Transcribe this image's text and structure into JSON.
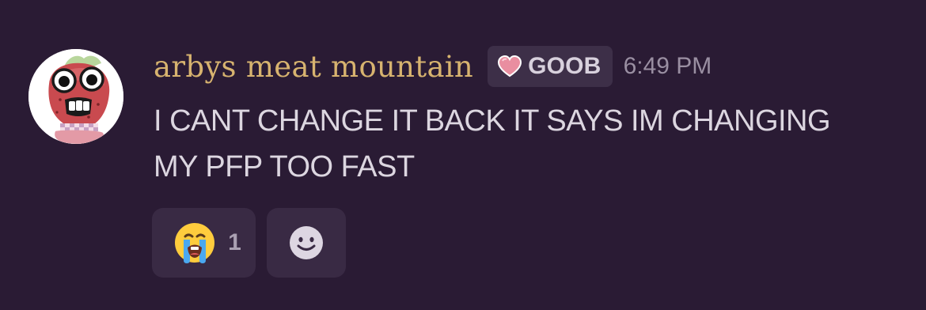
{
  "message": {
    "username": "arbys meat mountain",
    "tag": {
      "icon": "pink-heart-icon",
      "label": "GOOB"
    },
    "timestamp": "6:49 PM",
    "content": "I CANT CHANGE IT BACK IT SAYS IM CHANGING MY PFP TOO FAST",
    "avatar": "strawberry-cartoon-avatar"
  },
  "reactions": [
    {
      "emoji": "loudly-crying-face-icon",
      "count": "1"
    }
  ],
  "add_reaction": {
    "icon": "smiley-face-icon"
  },
  "colors": {
    "background": "#2a1b34",
    "username": "#d7b36f",
    "tag_background": "#3d2f48",
    "message_text": "#dcd6e0",
    "timestamp": "#9a8fa2",
    "reaction_background": "#392a44"
  }
}
